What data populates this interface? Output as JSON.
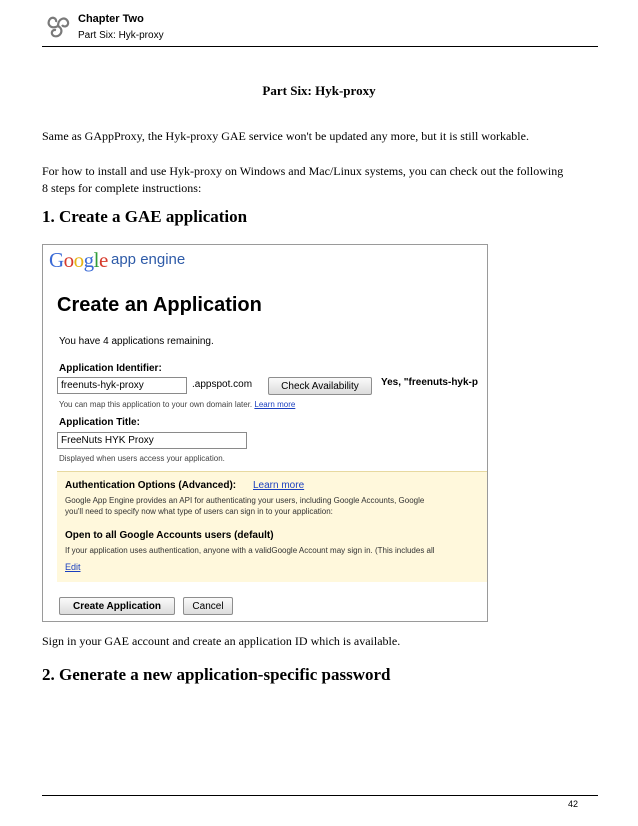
{
  "header": {
    "chapter": "Chapter Two",
    "part": "Part Six: Hyk-proxy"
  },
  "page": {
    "title": "Part Six: Hyk-proxy",
    "intro": "Same as GAppProxy, the Hyk-proxy GAE service won't be updated any more, but it is still workable.",
    "howto_line1": "For how to install and use Hyk-proxy on Windows and Mac/Linux systems, you can check out the following",
    "howto_line2": "8 steps for complete instructions:",
    "step1_heading": "1. Create a GAE application",
    "caption": "Sign in your GAE account and create an application ID which is available.",
    "step2_heading": "2. Generate a new application-specific password",
    "page_number": "42"
  },
  "screenshot": {
    "logo_letters": [
      "G",
      "o",
      "o",
      "g",
      "l",
      "e"
    ],
    "logo_colors": [
      "#3b6bd6",
      "#d63a2b",
      "#e7b416",
      "#3b6bd6",
      "#2f9c3a",
      "#d63a2b"
    ],
    "app_engine": "app engine",
    "create_title": "Create an Application",
    "remaining": "You have 4 applications remaining.",
    "id_label": "Application Identifier:",
    "id_value": "freenuts-hyk-proxy",
    "id_suffix": ".appspot.com",
    "check_button": "Check Availability",
    "yes_text": "Yes, \"freenuts-hyk-p",
    "map_hint": "You can map this application to your own domain later.",
    "learn_more": "Learn more",
    "title_label": "Application Title:",
    "title_value": "FreeNuts HYK Proxy",
    "title_hint": "Displayed when users access your application.",
    "auth_title": "Authentication Options (Advanced):",
    "auth_learn_more": "Learn more",
    "auth_text1": "Google App Engine provides an API for authenticating your users, including Google Accounts, Google",
    "auth_text2": "you'll need to specify now what type of users can sign in to your application:",
    "open_title": "Open to all Google Accounts users (default)",
    "open_text": "If your application uses authentication, anyone with a validGoogle Account may sign in. (This includes all",
    "edit": "Edit",
    "create_button": "Create Application",
    "cancel_button": "Cancel"
  }
}
